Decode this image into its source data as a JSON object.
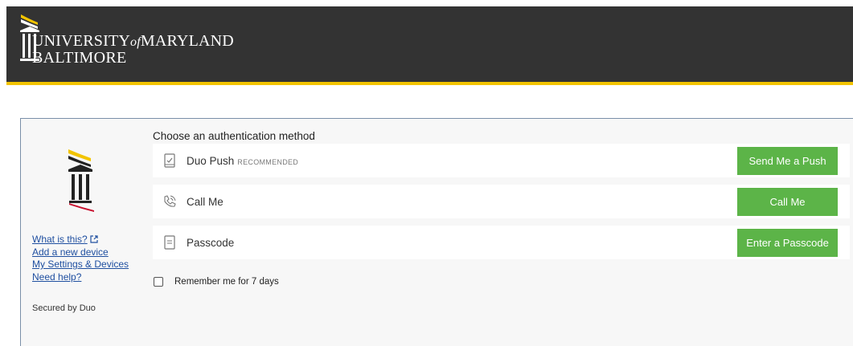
{
  "header": {
    "logo_line1_a": "UNIVERSITY",
    "logo_line1_of": "of",
    "logo_line1_b": "MARYLAND",
    "logo_line2": "BALTIMORE"
  },
  "colors": {
    "header_bg": "#333333",
    "accent_yellow": "#f2c400",
    "accent_red": "#c8102e",
    "button_green": "#5cb448",
    "link_blue": "#1f4fa0"
  },
  "auth": {
    "title": "Choose an authentication method",
    "methods": [
      {
        "icon": "phone-icon",
        "label": "Duo Push",
        "badge": "RECOMMENDED",
        "button": "Send Me a Push"
      },
      {
        "icon": "call-icon",
        "label": "Call Me",
        "badge": "",
        "button": "Call Me"
      },
      {
        "icon": "passcode-icon",
        "label": "Passcode",
        "badge": "",
        "button": "Enter a Passcode"
      }
    ],
    "remember_label": "Remember me for 7 days",
    "remember_checked": false
  },
  "sidebar": {
    "links": [
      {
        "label": "What is this?",
        "icon": "external-link-icon"
      },
      {
        "label": "Add a new device"
      },
      {
        "label": "My Settings & Devices"
      },
      {
        "label": "Need help?"
      }
    ],
    "secured": "Secured by Duo"
  }
}
